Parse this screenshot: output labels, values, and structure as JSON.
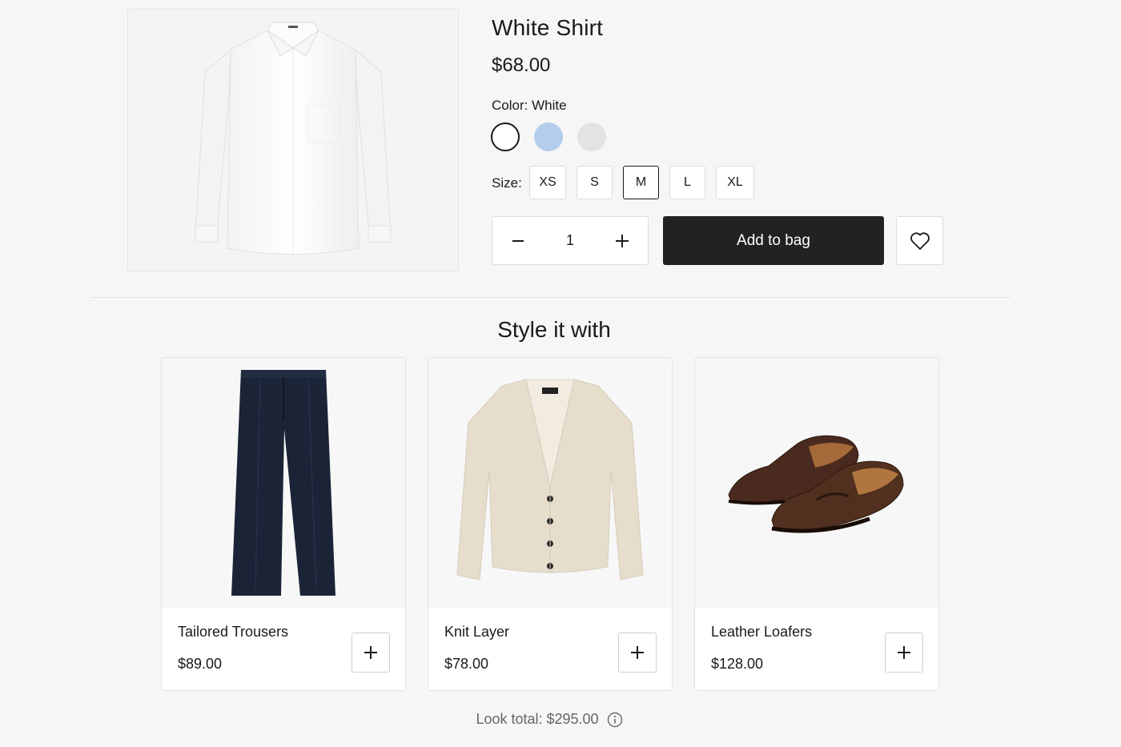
{
  "product": {
    "title": "White Shirt",
    "price": "$68.00",
    "color_label": "Color: White",
    "colors": [
      "#ffffff",
      "#b3cdeb",
      "#e3e3e3"
    ],
    "size_label": "Size:",
    "sizes": [
      "XS",
      "S",
      "M",
      "L",
      "XL"
    ],
    "selected_size": "M",
    "quantity": "1",
    "add_to_bag": "Add to bag"
  },
  "style_section": {
    "title": "Style it with",
    "items": [
      {
        "name": "Tailored Trousers",
        "price": "$89.00",
        "icon": "trousers-image"
      },
      {
        "name": "Knit Layer",
        "price": "$78.00",
        "icon": "cardigan-image"
      },
      {
        "name": "Leather Loafers",
        "price": "$128.00",
        "icon": "loafers-image"
      }
    ]
  },
  "look_total": "Look total: $295.00",
  "colors": {
    "accent": "#222222",
    "background": "#f6f6f6"
  }
}
